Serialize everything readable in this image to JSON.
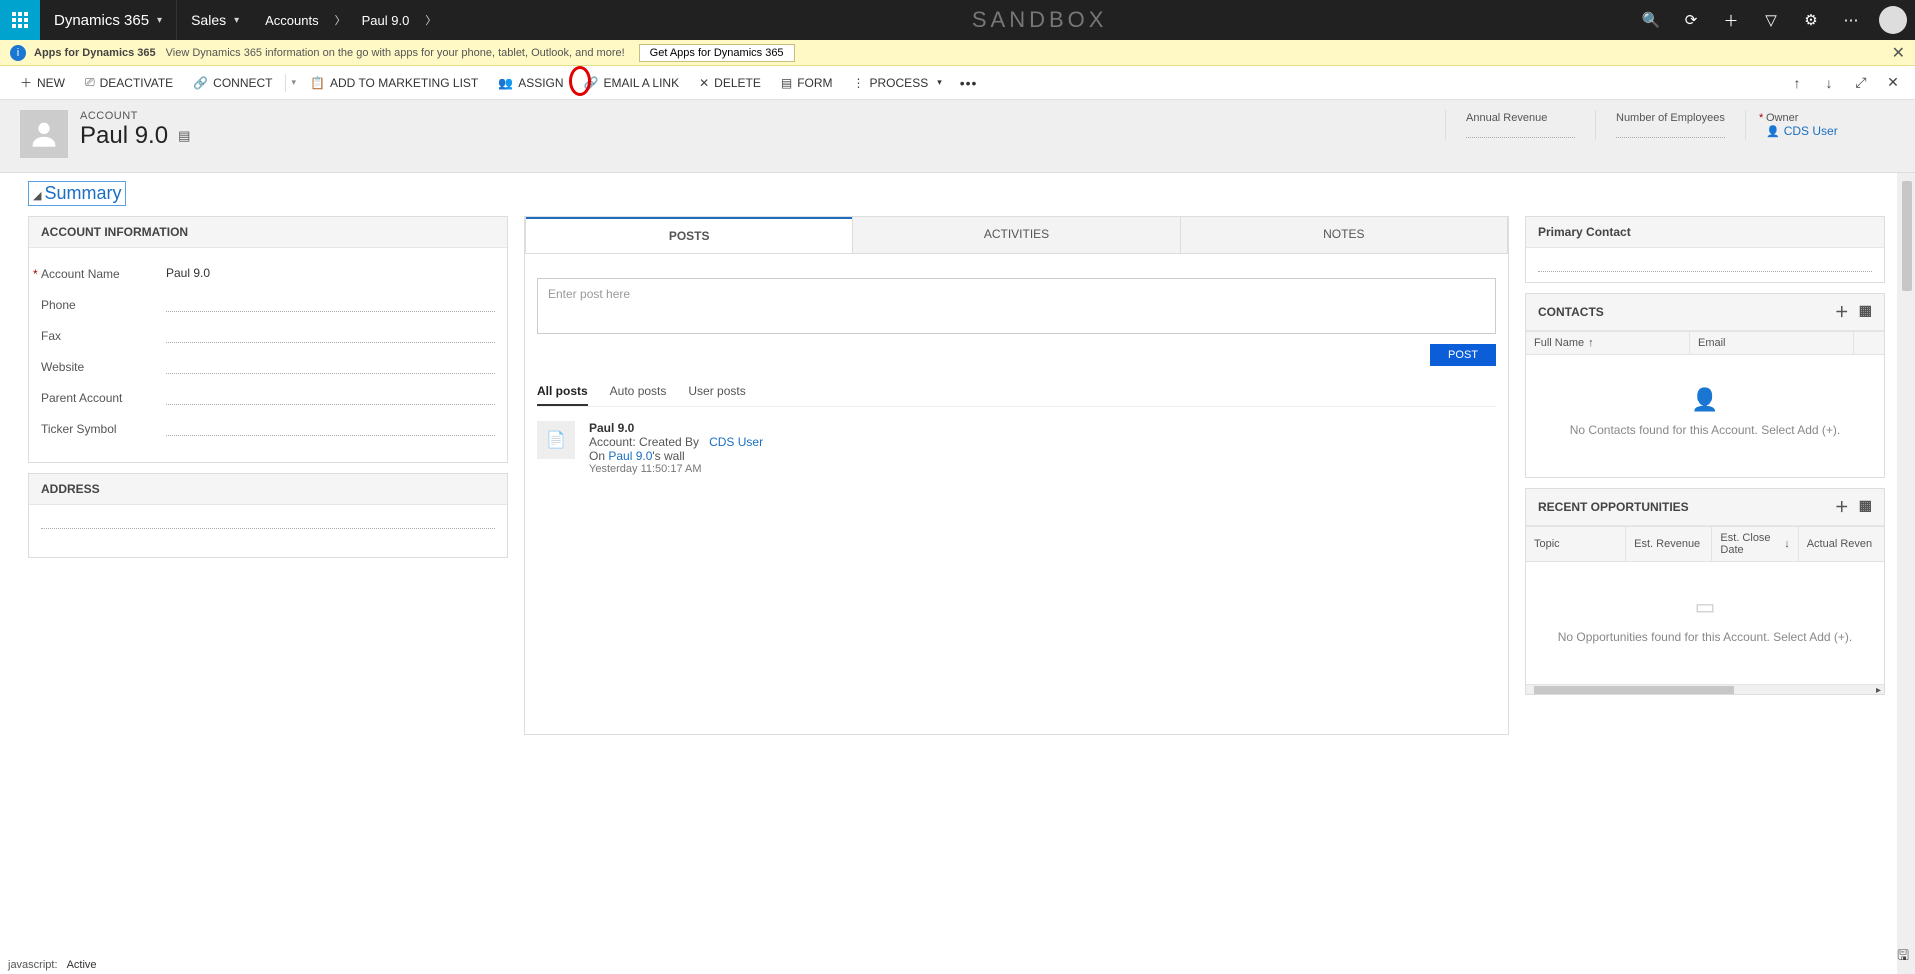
{
  "topnav": {
    "brand": "Dynamics 365",
    "area": "Sales",
    "breadcrumb": [
      "Accounts",
      "Paul 9.0"
    ],
    "sandbox": "SANDBOX"
  },
  "infobar": {
    "title": "Apps for Dynamics 365",
    "text": "View Dynamics 365 information on the go with apps for your phone, tablet, Outlook, and more!",
    "button": "Get Apps for Dynamics 365"
  },
  "cmd": {
    "new": "NEW",
    "deactivate": "DEACTIVATE",
    "connect": "CONNECT",
    "addtolist": "ADD TO MARKETING LIST",
    "assign": "ASSIGN",
    "emaillink": "EMAIL A LINK",
    "delete": "DELETE",
    "form": "FORM",
    "process": "PROCESS"
  },
  "record": {
    "entity": "ACCOUNT",
    "name": "Paul 9.0",
    "summary": "Summary",
    "header_fields": {
      "annual_rev": "Annual Revenue",
      "num_emp": "Number of Employees",
      "owner_label": "Owner",
      "owner_value": "CDS User"
    }
  },
  "account_info": {
    "title": "ACCOUNT INFORMATION",
    "rows": {
      "account_name_label": "Account Name",
      "account_name_value": "Paul 9.0",
      "phone": "Phone",
      "fax": "Fax",
      "website": "Website",
      "parent": "Parent Account",
      "ticker": "Ticker Symbol"
    },
    "address_title": "ADDRESS"
  },
  "posts": {
    "tabs": {
      "posts": "POSTS",
      "activities": "ACTIVITIES",
      "notes": "NOTES"
    },
    "placeholder": "Enter post here",
    "post_btn": "POST",
    "subtabs": {
      "all": "All posts",
      "auto": "Auto posts",
      "user": "User posts"
    },
    "item": {
      "title": "Paul 9.0",
      "line_prefix": "Account: Created By",
      "by": "CDS User",
      "on_prefix": "On ",
      "on_link": "Paul 9.0",
      "on_suffix": "'s wall",
      "time": "Yesterday 11:50:17 AM"
    }
  },
  "right": {
    "primary_contact": "Primary Contact",
    "contacts": {
      "title": "CONTACTS",
      "cols": {
        "fullname": "Full Name",
        "email": "Email"
      },
      "empty": "No Contacts found for this Account. Select Add (+)."
    },
    "opps": {
      "title": "RECENT OPPORTUNITIES",
      "cols": {
        "topic": "Topic",
        "estrev": "Est. Revenue",
        "estclose": "Est. Close Date",
        "actual": "Actual Reven"
      },
      "empty": "No Opportunities found for this Account. Select Add (+)."
    }
  },
  "status": {
    "left": "javascript:",
    "active": "Active"
  }
}
